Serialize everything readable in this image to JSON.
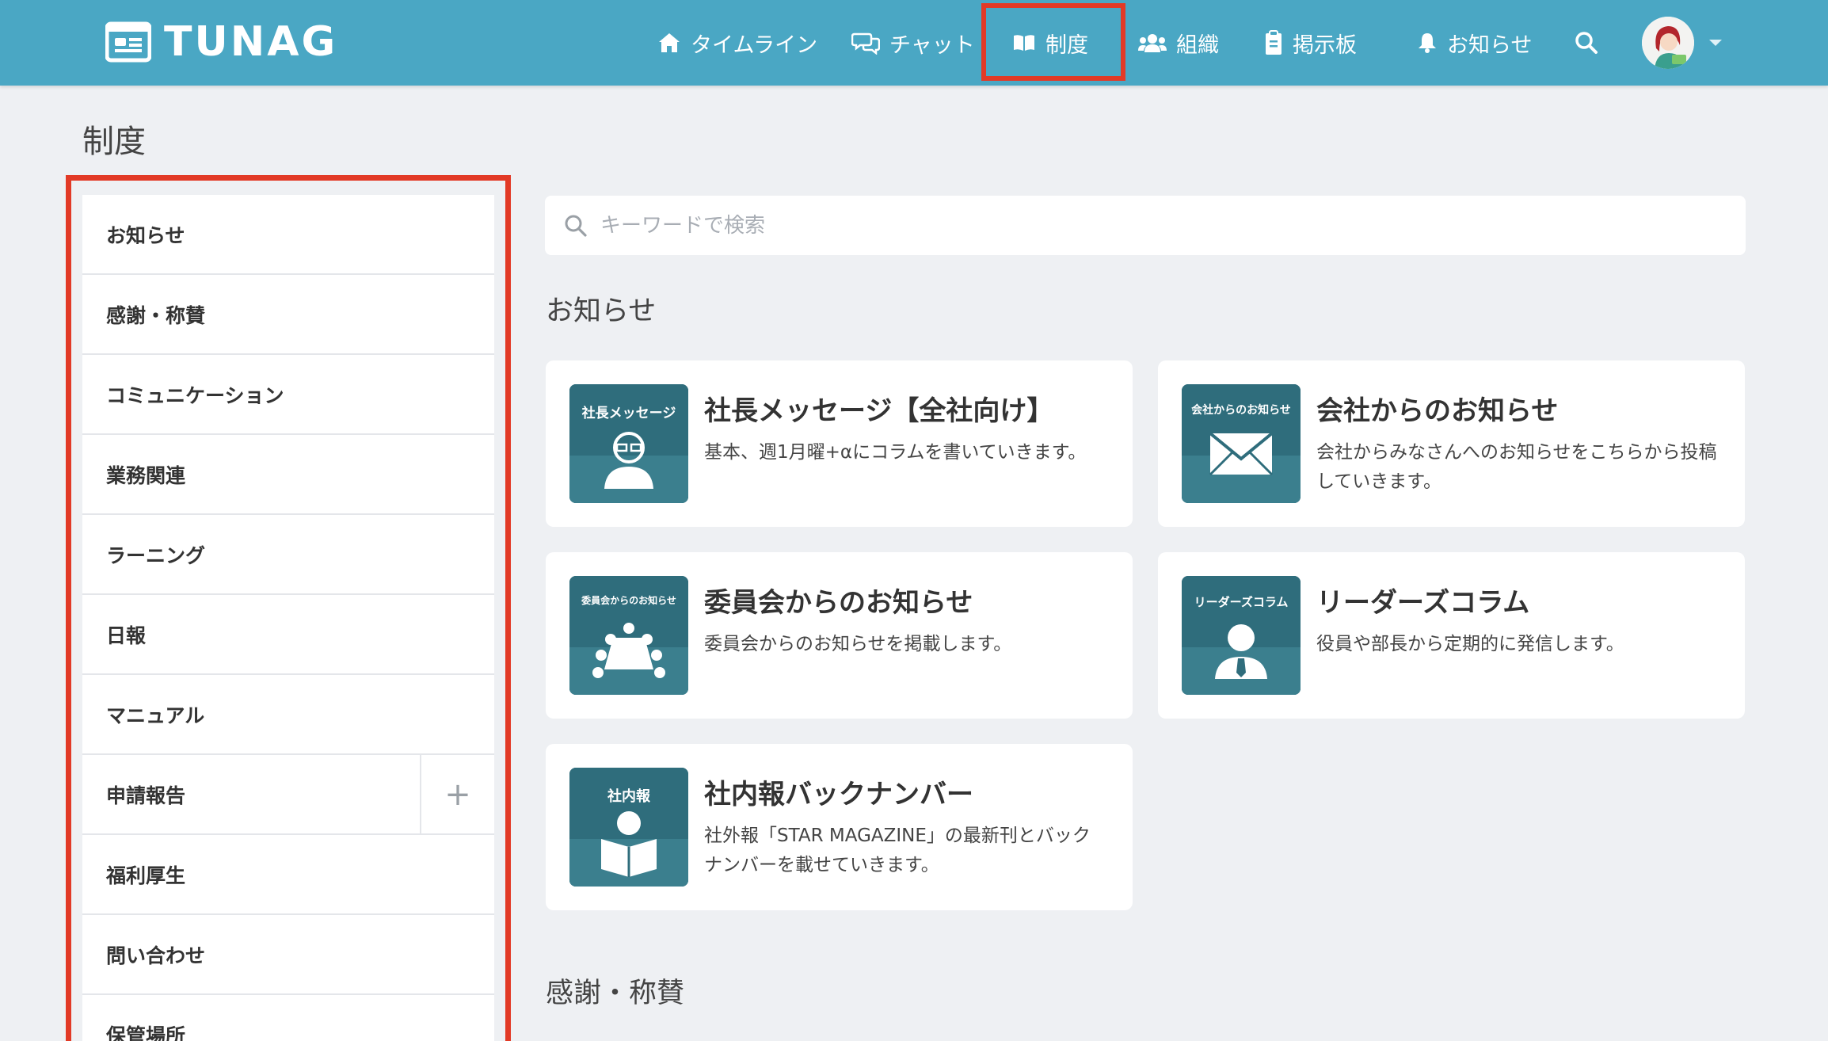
{
  "header": {
    "logo_text": "TUNAG",
    "nav": [
      {
        "label": "タイムライン",
        "icon": "home-icon"
      },
      {
        "label": "チャット",
        "icon": "chat-icon"
      },
      {
        "label": "制度",
        "icon": "book-icon",
        "active": true
      },
      {
        "label": "組織",
        "icon": "users-icon"
      },
      {
        "label": "掲示板",
        "icon": "clipboard-icon"
      },
      {
        "label": "お知らせ",
        "icon": "bell-icon"
      }
    ],
    "search_icon": "search-icon",
    "user_menu_icon": "caret-down-icon"
  },
  "page": {
    "title": "制度"
  },
  "sidebar": {
    "items": [
      {
        "label": "お知らせ"
      },
      {
        "label": "感謝・称賛"
      },
      {
        "label": "コミュニケーション"
      },
      {
        "label": "業務関連"
      },
      {
        "label": "ラーニング"
      },
      {
        "label": "日報"
      },
      {
        "label": "マニュアル"
      },
      {
        "label": "申請報告",
        "expand": "+"
      },
      {
        "label": "福利厚生"
      },
      {
        "label": "問い合わせ"
      },
      {
        "label": "保管場所"
      }
    ]
  },
  "search": {
    "placeholder": "キーワードで検索"
  },
  "sections": [
    {
      "title": "お知らせ",
      "cards": [
        {
          "thumb_label": "社長メッセージ",
          "thumb_icon": "person-glasses-icon",
          "title": "社長メッセージ【全社向け】",
          "desc": "基本、週1月曜+αにコラムを書いていきます。"
        },
        {
          "thumb_label": "会社からのお知らせ",
          "thumb_icon": "envelope-icon",
          "title": "会社からのお知らせ",
          "desc": "会社からみなさんへのお知らせをこちらから投稿していきます。"
        },
        {
          "thumb_label": "委員会からのお知らせ",
          "thumb_icon": "meeting-icon",
          "title": "委員会からのお知らせ",
          "desc": "委員会からのお知らせを掲載します。"
        },
        {
          "thumb_label": "リーダーズコラム",
          "thumb_icon": "person-tie-icon",
          "title": "リーダーズコラム",
          "desc": "役員や部長から定期的に発信します。"
        },
        {
          "thumb_label": "社内報",
          "thumb_icon": "reader-icon",
          "title": "社内報バックナンバー",
          "desc": "社外報「STAR MAGAZINE」の最新刊とバックナンバーを載せていきます。"
        }
      ]
    },
    {
      "title": "感謝・称賛"
    }
  ],
  "colors": {
    "header": "#4aa7c4",
    "highlight": "#e23a26",
    "thumb": "#2f6d7c",
    "background": "#eef0f3"
  }
}
